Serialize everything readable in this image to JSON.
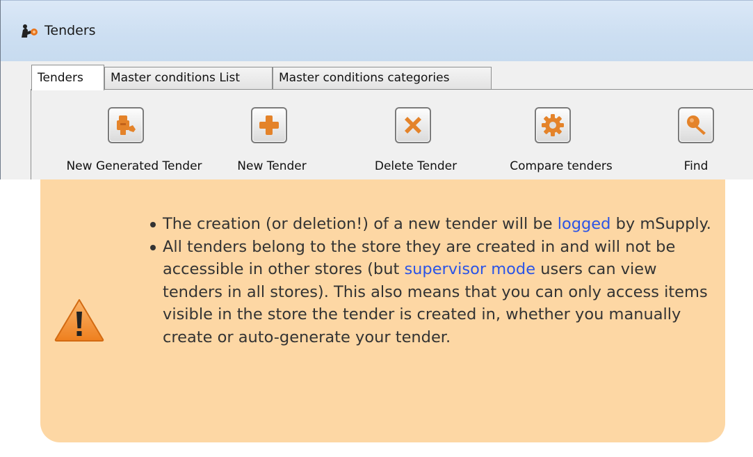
{
  "window": {
    "title": "Tenders",
    "tabs": [
      {
        "label": "Tenders",
        "active": true
      },
      {
        "label": "Master conditions List",
        "active": false
      },
      {
        "label": "Master conditions categories",
        "active": false
      }
    ],
    "toolbar": {
      "new_generated_tender": {
        "label": "New Generated Tender",
        "icon": "generate-icon"
      },
      "new_tender": {
        "label": "New Tender",
        "icon": "plus-icon"
      },
      "delete_tender": {
        "label": "Delete Tender",
        "icon": "x-icon"
      },
      "compare_tenders": {
        "label": "Compare tenders",
        "icon": "gear-icon"
      },
      "find": {
        "label": "Find",
        "icon": "magnifier-icon"
      }
    }
  },
  "note": {
    "icon": "warning-icon",
    "background_color": "#fdd7a4",
    "link_color": "#2b54e6",
    "items": [
      {
        "text_1": "The creation (or deletion!) of a new tender will be ",
        "link_1": "logged",
        "text_2": " by mSupply."
      },
      {
        "text_1": "All tenders belong to the store they are created in and will not be accessible in other stores (but ",
        "link_1": "supervisor mode",
        "text_2": " users can view tenders in all stores). This also means that you can only access items visible in the store the tender is created in, whether you manually create or auto-generate your tender."
      }
    ]
  }
}
